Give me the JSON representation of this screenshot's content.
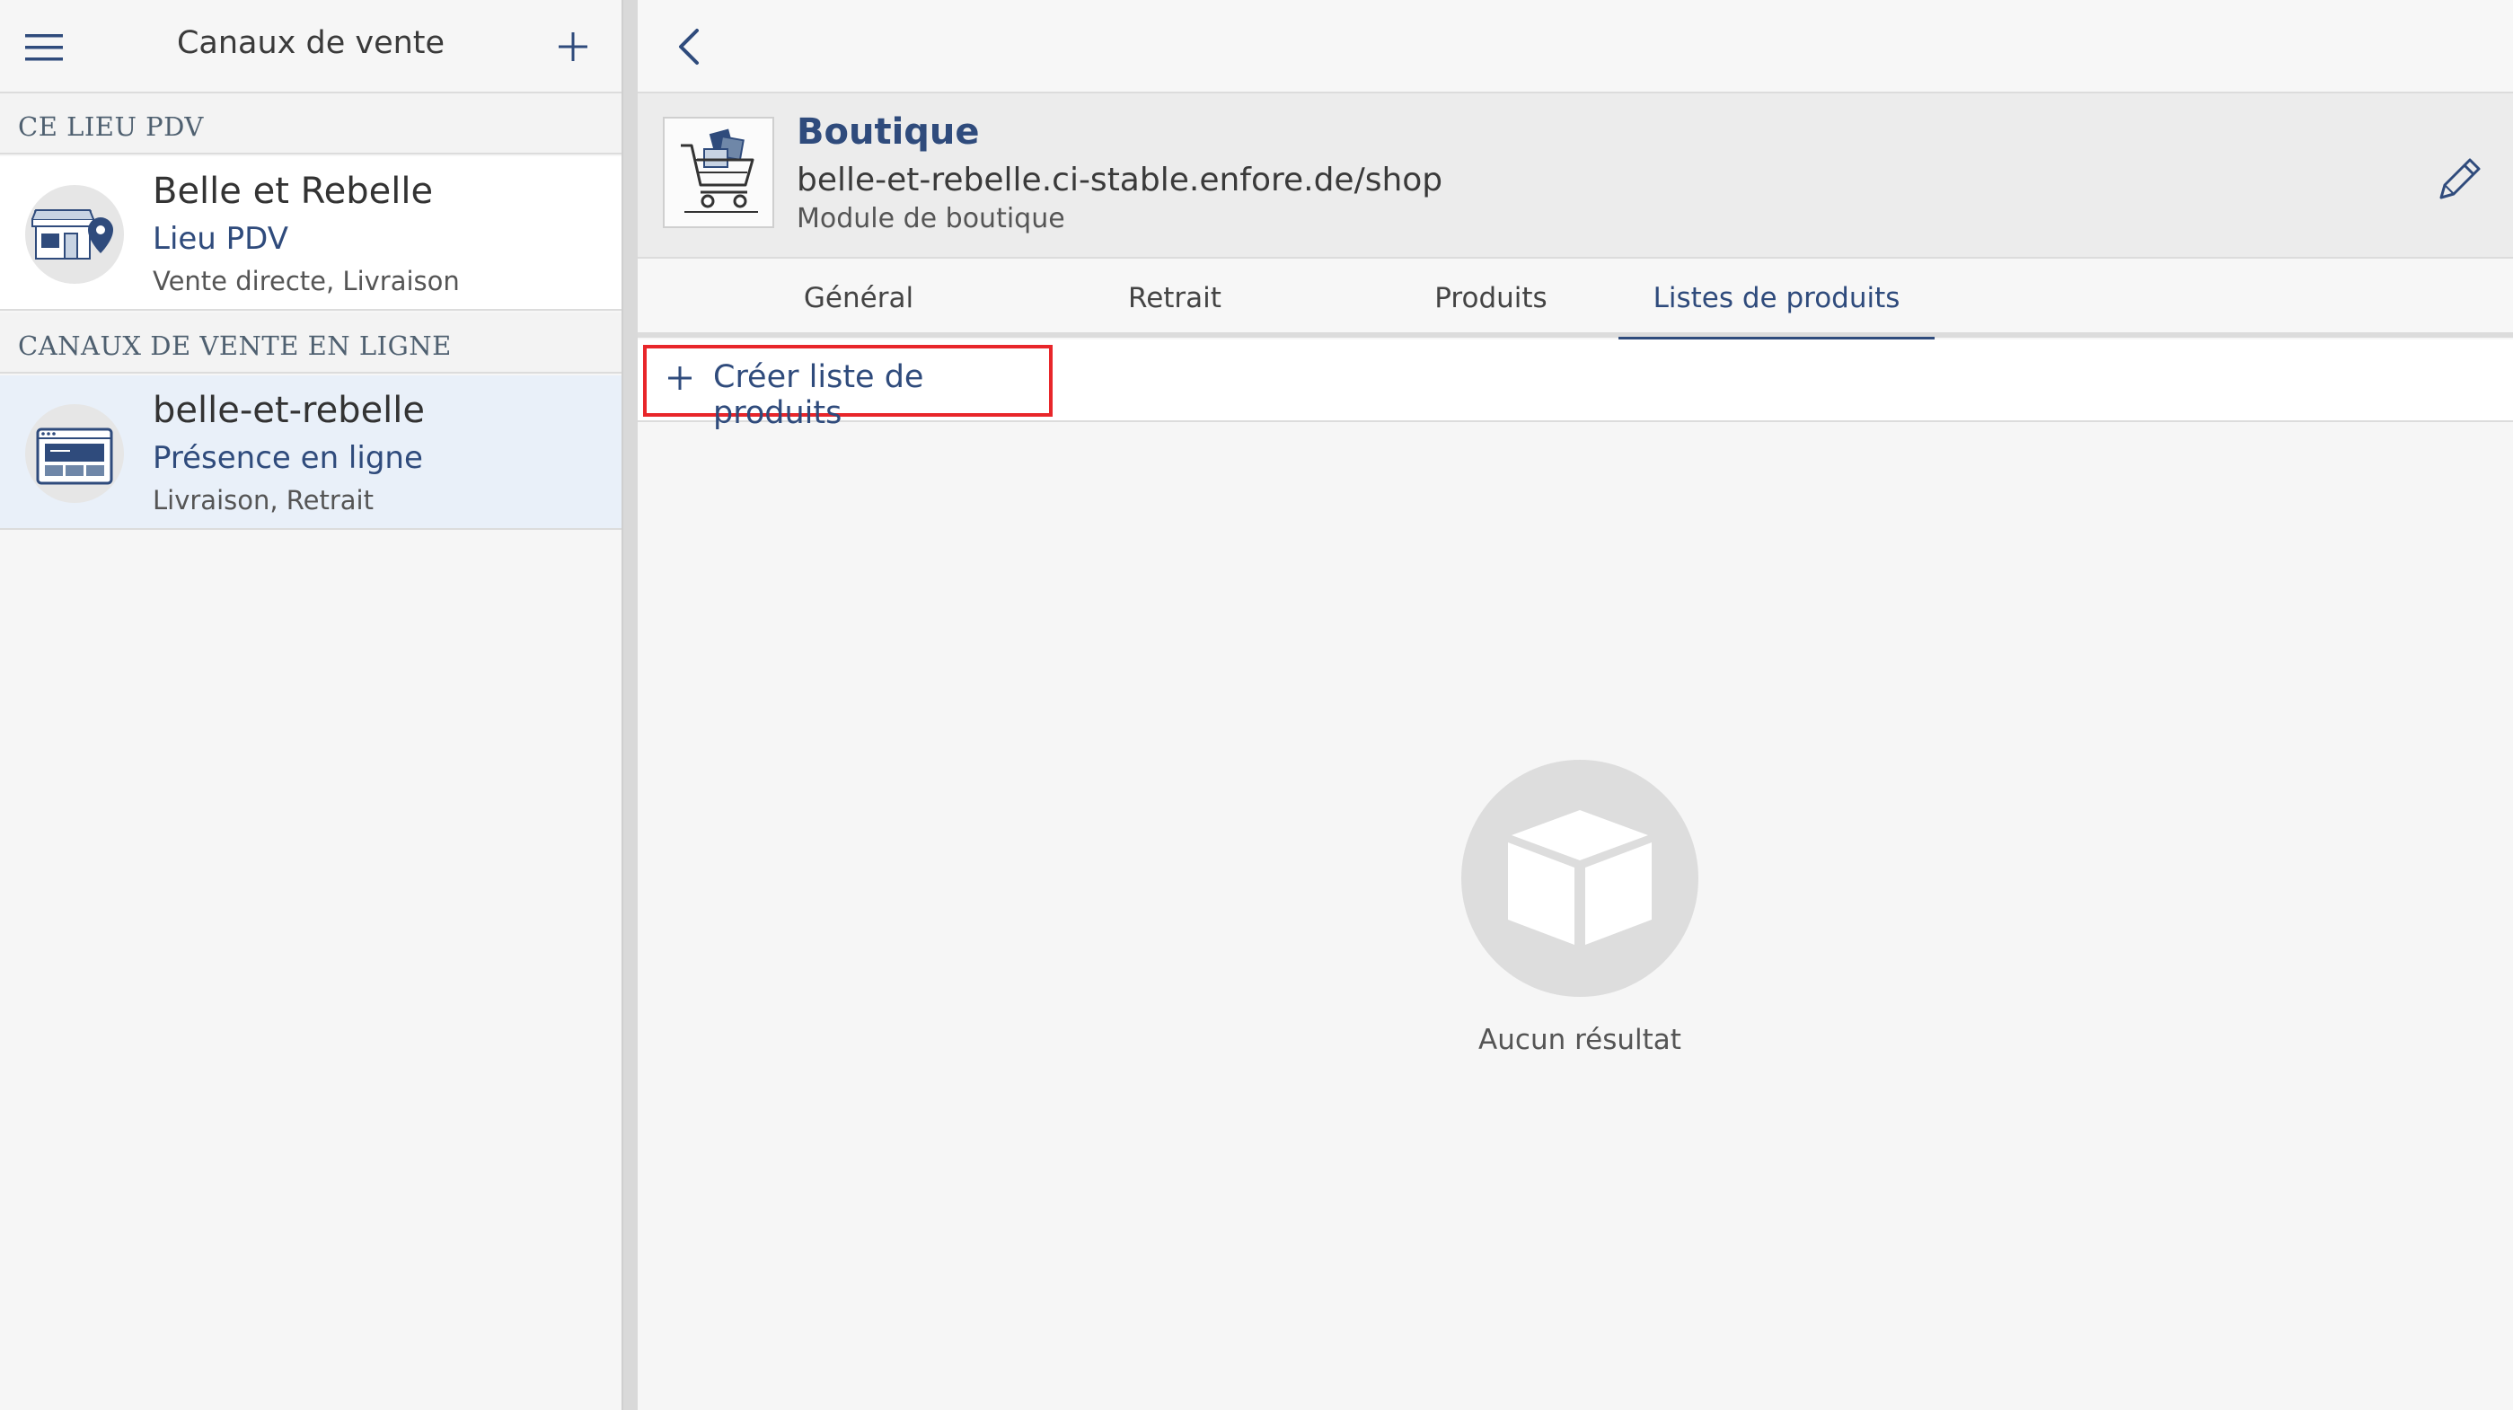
{
  "sidebar": {
    "title": "Canaux de vente",
    "menu_icon": "hamburger-menu-icon",
    "add_icon": "plus-icon",
    "sections": [
      {
        "header": "CE LIEU PDV",
        "items": [
          {
            "name": "Belle et Rebelle",
            "type": "Lieu PDV",
            "meta": "Vente directe, Livraison",
            "icon": "storefront-location-icon"
          }
        ]
      },
      {
        "header": "CANAUX DE VENTE EN LIGNE",
        "items": [
          {
            "name": "belle-et-rebelle",
            "type": "Présence en ligne",
            "meta": "Livraison, Retrait",
            "icon": "browser-window-icon"
          }
        ]
      }
    ]
  },
  "detail": {
    "back_icon": "chevron-left-icon",
    "title": "Boutique",
    "url": "belle-et-rebelle.ci-stable.enfore.de/shop",
    "module": "Module de boutique",
    "image_icon": "shopping-cart-box-icon",
    "edit_icon": "pencil-icon",
    "tabs": [
      {
        "label": "Général"
      },
      {
        "label": "Retrait"
      },
      {
        "label": "Produits"
      },
      {
        "label": "Listes de produits"
      }
    ],
    "active_tab": "Listes de produits",
    "create_label": "Créer liste de produits",
    "empty_icon": "empty-box-icon",
    "empty_text": "Aucun résultat"
  },
  "colors": {
    "accent": "#2f4b7c",
    "highlight": "#e8262a",
    "selected_row": "#e9f0f9"
  }
}
